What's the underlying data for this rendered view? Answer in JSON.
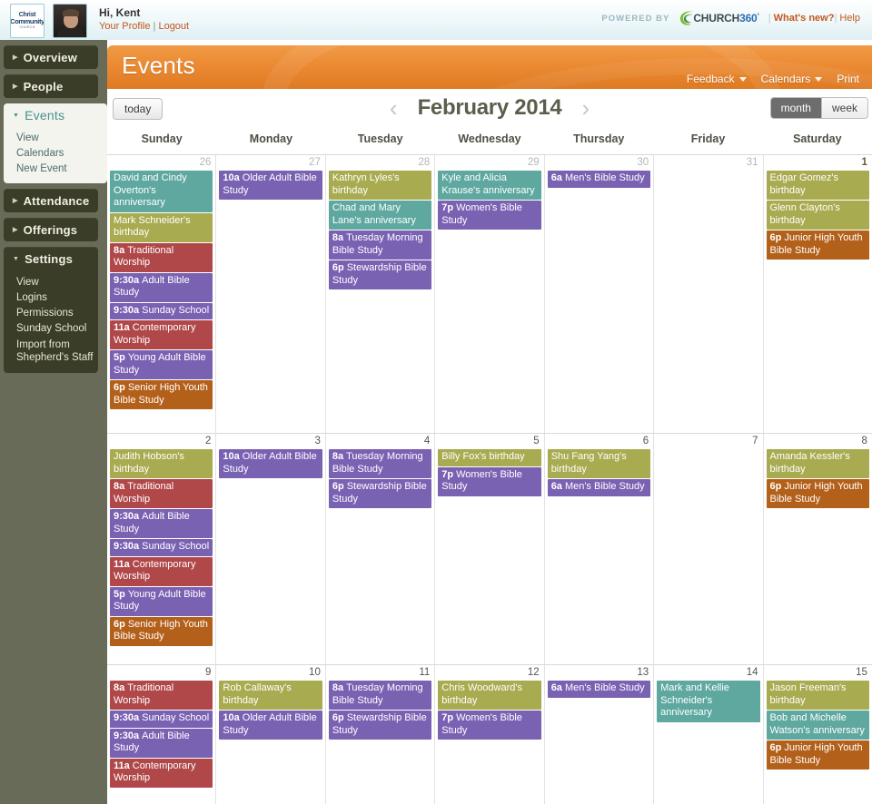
{
  "topbar": {
    "logo": {
      "line1": "Christ",
      "line2": "Community",
      "line3": "CHURCH"
    },
    "greeting": "Hi, Kent",
    "profile_link": "Your Profile",
    "link_separator": "|",
    "logout_link": "Logout",
    "powered_by": "POWERED BY",
    "brand_name": "CHURCH",
    "brand_num": "360",
    "brand_tm": "°",
    "whats_new": "What's new?",
    "help": "Help"
  },
  "sidebar": {
    "items": [
      {
        "label": "Overview",
        "state": "collapsed",
        "children": []
      },
      {
        "label": "People",
        "state": "collapsed",
        "children": []
      },
      {
        "label": "Events",
        "state": "expanded-active",
        "children": [
          "View",
          "Calendars",
          "New Event"
        ]
      },
      {
        "label": "Attendance",
        "state": "collapsed",
        "children": []
      },
      {
        "label": "Offerings",
        "state": "collapsed",
        "children": []
      },
      {
        "label": "Settings",
        "state": "expanded",
        "children": [
          "View",
          "Logins",
          "Permissions",
          "Sunday School",
          "Import from Shepherd's Staff"
        ]
      }
    ]
  },
  "banner": {
    "title": "Events",
    "menu": [
      {
        "label": "Feedback",
        "has_caret": true
      },
      {
        "label": "Calendars",
        "has_caret": true
      },
      {
        "label": "Print",
        "has_caret": false
      }
    ]
  },
  "toolbar": {
    "today_label": "today",
    "prev_arrow": "‹",
    "next_arrow": "›",
    "month_title": "February 2014",
    "view_month": "month",
    "view_week": "week",
    "active_view": "month"
  },
  "calendar": {
    "day_headers": [
      "Sunday",
      "Monday",
      "Tuesday",
      "Wednesday",
      "Thursday",
      "Friday",
      "Saturday"
    ],
    "colors": {
      "anniversary": "#5fa8a0",
      "birthday": "#a9ab51",
      "worship": "#b0484a",
      "bible_study": "#7a62b3",
      "youth": "#b3601a"
    },
    "weeks": [
      {
        "days": [
          {
            "num": "26",
            "other_month": true,
            "events": [
              {
                "time": "",
                "title": "David and Cindy Overton's anniversary",
                "color": "teal"
              },
              {
                "time": "",
                "title": "Mark Schneider's birthday",
                "color": "olive"
              },
              {
                "time": "8a",
                "title": "Traditional Worship",
                "color": "red"
              },
              {
                "time": "9:30a",
                "title": "Adult Bible Study",
                "color": "purple"
              },
              {
                "time": "9:30a",
                "title": "Sunday School",
                "color": "purple"
              },
              {
                "time": "11a",
                "title": "Contemporary Worship",
                "color": "red"
              },
              {
                "time": "5p",
                "title": "Young Adult Bible Study",
                "color": "purple"
              },
              {
                "time": "6p",
                "title": "Senior High Youth Bible Study",
                "color": "brown"
              }
            ]
          },
          {
            "num": "27",
            "other_month": true,
            "events": [
              {
                "time": "10a",
                "title": "Older Adult Bible Study",
                "color": "purple"
              }
            ]
          },
          {
            "num": "28",
            "other_month": true,
            "events": [
              {
                "time": "",
                "title": "Kathryn Lyles's birthday",
                "color": "olive"
              },
              {
                "time": "",
                "title": "Chad and Mary Lane's anniversary",
                "color": "teal"
              },
              {
                "time": "8a",
                "title": "Tuesday Morning Bible Study",
                "color": "purple"
              },
              {
                "time": "6p",
                "title": "Stewardship Bible Study",
                "color": "purple"
              }
            ]
          },
          {
            "num": "29",
            "other_month": true,
            "events": [
              {
                "time": "",
                "title": "Kyle and Alicia Krause's anniversary",
                "color": "teal"
              },
              {
                "time": "7p",
                "title": "Women's Bible Study",
                "color": "purple"
              }
            ]
          },
          {
            "num": "30",
            "other_month": true,
            "events": [
              {
                "time": "6a",
                "title": "Men's Bible Study",
                "color": "purple"
              }
            ]
          },
          {
            "num": "31",
            "other_month": true,
            "events": []
          },
          {
            "num": "1",
            "other_month": false,
            "first": true,
            "events": [
              {
                "time": "",
                "title": "Edgar Gomez's birthday",
                "color": "olive"
              },
              {
                "time": "",
                "title": "Glenn Clayton's birthday",
                "color": "olive"
              },
              {
                "time": "6p",
                "title": "Junior High Youth Bible Study",
                "color": "brown"
              }
            ]
          }
        ]
      },
      {
        "days": [
          {
            "num": "2",
            "other_month": false,
            "events": [
              {
                "time": "",
                "title": "Judith Hobson's birthday",
                "color": "olive"
              },
              {
                "time": "8a",
                "title": "Traditional Worship",
                "color": "red"
              },
              {
                "time": "9:30a",
                "title": "Adult Bible Study",
                "color": "purple"
              },
              {
                "time": "9:30a",
                "title": "Sunday School",
                "color": "purple"
              },
              {
                "time": "11a",
                "title": "Contemporary Worship",
                "color": "red"
              },
              {
                "time": "5p",
                "title": "Young Adult Bible Study",
                "color": "purple"
              },
              {
                "time": "6p",
                "title": "Senior High Youth Bible Study",
                "color": "brown"
              }
            ]
          },
          {
            "num": "3",
            "other_month": false,
            "events": [
              {
                "time": "10a",
                "title": "Older Adult Bible Study",
                "color": "purple"
              }
            ]
          },
          {
            "num": "4",
            "other_month": false,
            "events": [
              {
                "time": "8a",
                "title": "Tuesday Morning Bible Study",
                "color": "purple"
              },
              {
                "time": "6p",
                "title": "Stewardship Bible Study",
                "color": "purple"
              }
            ]
          },
          {
            "num": "5",
            "other_month": false,
            "events": [
              {
                "time": "",
                "title": "Billy Fox's birthday",
                "color": "olive"
              },
              {
                "time": "7p",
                "title": "Women's Bible Study",
                "color": "purple"
              }
            ]
          },
          {
            "num": "6",
            "other_month": false,
            "events": [
              {
                "time": "",
                "title": "Shu Fang Yang's birthday",
                "color": "olive"
              },
              {
                "time": "6a",
                "title": "Men's Bible Study",
                "color": "purple"
              }
            ]
          },
          {
            "num": "7",
            "other_month": false,
            "events": []
          },
          {
            "num": "8",
            "other_month": false,
            "events": [
              {
                "time": "",
                "title": "Amanda Kessler's birthday",
                "color": "olive"
              },
              {
                "time": "6p",
                "title": "Junior High Youth Bible Study",
                "color": "brown"
              }
            ]
          }
        ]
      },
      {
        "days": [
          {
            "num": "9",
            "other_month": false,
            "events": [
              {
                "time": "8a",
                "title": "Traditional Worship",
                "color": "red"
              },
              {
                "time": "9:30a",
                "title": "Sunday School",
                "color": "purple"
              },
              {
                "time": "9:30a",
                "title": "Adult Bible Study",
                "color": "purple"
              },
              {
                "time": "11a",
                "title": "Contemporary Worship",
                "color": "red"
              }
            ]
          },
          {
            "num": "10",
            "other_month": false,
            "events": [
              {
                "time": "",
                "title": "Rob Callaway's birthday",
                "color": "olive"
              },
              {
                "time": "10a",
                "title": "Older Adult Bible Study",
                "color": "purple"
              }
            ]
          },
          {
            "num": "11",
            "other_month": false,
            "events": [
              {
                "time": "8a",
                "title": "Tuesday Morning Bible Study",
                "color": "purple"
              },
              {
                "time": "6p",
                "title": "Stewardship Bible Study",
                "color": "purple"
              }
            ]
          },
          {
            "num": "12",
            "other_month": false,
            "events": [
              {
                "time": "",
                "title": "Chris Woodward's birthday",
                "color": "olive"
              },
              {
                "time": "7p",
                "title": "Women's Bible Study",
                "color": "purple"
              }
            ]
          },
          {
            "num": "13",
            "other_month": false,
            "events": [
              {
                "time": "6a",
                "title": "Men's Bible Study",
                "color": "purple"
              }
            ]
          },
          {
            "num": "14",
            "other_month": false,
            "events": [
              {
                "time": "",
                "title": "Mark and Kellie Schneider's anniversary",
                "color": "teal"
              }
            ]
          },
          {
            "num": "15",
            "other_month": false,
            "events": [
              {
                "time": "",
                "title": "Jason Freeman's birthday",
                "color": "olive"
              },
              {
                "time": "",
                "title": "Bob and Michelle Watson's anniversary",
                "color": "teal"
              },
              {
                "time": "6p",
                "title": "Junior High Youth Bible Study",
                "color": "brown"
              }
            ]
          }
        ]
      }
    ]
  }
}
